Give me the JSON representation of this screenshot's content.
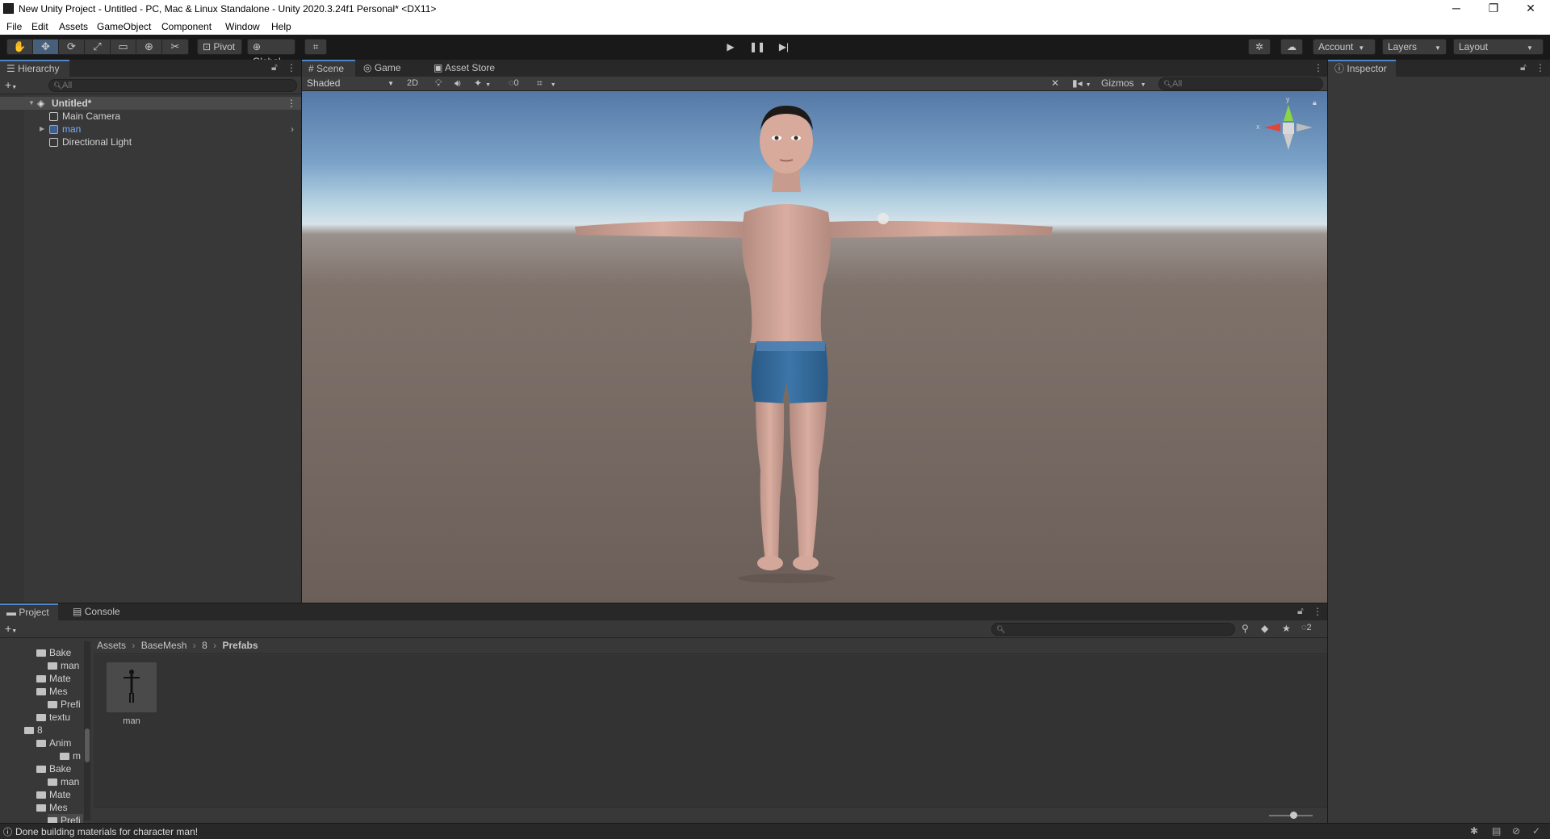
{
  "window": {
    "title": "New Unity Project - Untitled - PC, Mac & Linux Standalone - Unity 2020.3.24f1 Personal* <DX11>",
    "minimize": "─",
    "restore": "❐",
    "close": "✕"
  },
  "menu": [
    "File",
    "Edit",
    "Assets",
    "GameObject",
    "Component",
    "Window",
    "Help"
  ],
  "toolbar": {
    "tools": [
      "hand-tool",
      "move-tool",
      "rotate-tool",
      "scale-tool",
      "rect-tool",
      "transform-tool",
      "custom-tool"
    ],
    "active_tool": "move-tool",
    "pivot_label": "Pivot",
    "global_label": "Global",
    "account_label": "Account",
    "layers_label": "Layers",
    "layout_label": "Layout"
  },
  "hierarchy": {
    "tab_label": "Hierarchy",
    "search_placeholder": "All",
    "scene_name": "Untitled*",
    "items": [
      "Main Camera",
      "man",
      "Directional Light"
    ]
  },
  "scene_view": {
    "tabs": [
      "Scene",
      "Game",
      "Asset Store"
    ],
    "shading_mode": "Shaded",
    "mode_2d": "2D",
    "hidden_count": "0",
    "gizmos_label": "Gizmos",
    "search_placeholder": "All",
    "axis_labels": {
      "x": "x",
      "y": "y"
    }
  },
  "inspector": {
    "tab_label": "Inspector"
  },
  "project": {
    "tabs": [
      "Project",
      "Console"
    ],
    "tree": [
      "Bake",
      "man",
      "Mate",
      "Mes",
      "Prefi",
      "textu",
      "8",
      "Anim",
      "m",
      "Bake",
      "man",
      "Mate",
      "Mes",
      "Prefi"
    ],
    "breadcrumb": [
      "Assets",
      "BaseMesh",
      "8",
      "Prefabs"
    ],
    "assets": [
      {
        "name": "man"
      }
    ],
    "hidden_count": "2"
  },
  "status": {
    "message": "Done building materials for character man!"
  },
  "colors": {
    "selection_blue": "#4f87c8",
    "panel_bg": "#383838",
    "toolbar_bg": "#191919",
    "active_tool": "#46607c"
  }
}
